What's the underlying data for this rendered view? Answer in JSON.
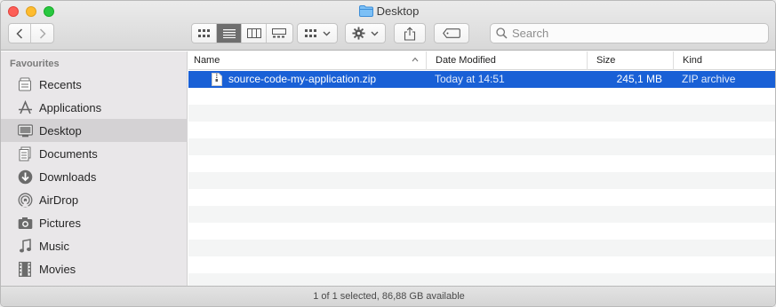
{
  "window": {
    "title": "Desktop"
  },
  "toolbar": {
    "back_label": "Back",
    "forward_label": "Forward",
    "view_modes": [
      "icon-view",
      "list-view",
      "column-view",
      "gallery-view"
    ],
    "active_view": "list-view",
    "group_menu": "group",
    "action_menu": "action",
    "share": "share",
    "tags": "tags",
    "search": {
      "placeholder": "Search",
      "value": ""
    }
  },
  "sidebar": {
    "heading": "Favourites",
    "items": [
      {
        "label": "Recents",
        "icon": "recents-icon"
      },
      {
        "label": "Applications",
        "icon": "applications-icon"
      },
      {
        "label": "Desktop",
        "icon": "desktop-icon",
        "selected": true
      },
      {
        "label": "Documents",
        "icon": "documents-icon"
      },
      {
        "label": "Downloads",
        "icon": "downloads-icon"
      },
      {
        "label": "AirDrop",
        "icon": "airdrop-icon"
      },
      {
        "label": "Pictures",
        "icon": "pictures-icon"
      },
      {
        "label": "Music",
        "icon": "music-icon"
      },
      {
        "label": "Movies",
        "icon": "movies-icon"
      }
    ]
  },
  "list": {
    "columns": {
      "name": "Name",
      "date": "Date Modified",
      "size": "Size",
      "kind": "Kind"
    },
    "rows": [
      {
        "name": "source-code-my-application.zip",
        "date": "Today at 14:51",
        "size": "245,1 MB",
        "kind": "ZIP archive",
        "selected": true
      }
    ]
  },
  "status": {
    "text": "1 of 1 selected, 86,88 GB available"
  },
  "colors": {
    "selection": "#1960d6",
    "accent_folder": "#4aa3f0"
  }
}
